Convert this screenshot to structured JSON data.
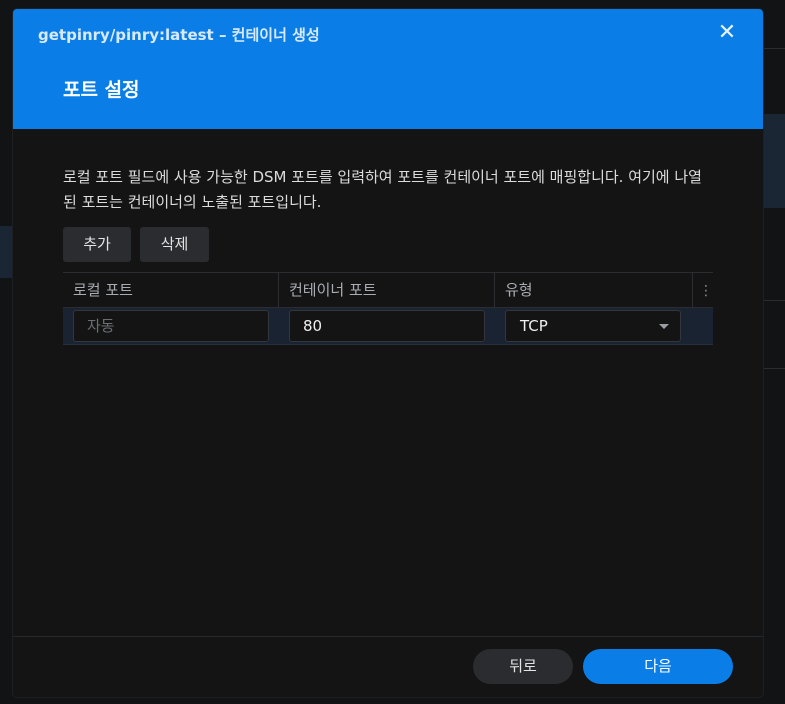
{
  "window": {
    "title": "getpinry/pinry:latest – 컨테이너 생성",
    "close_glyph": "✕"
  },
  "step": {
    "title": "포트 설정"
  },
  "description": "로컬 포트 필드에 사용 가능한 DSM 포트를 입력하여 포트를 컨테이너 포트에 매핑합니다. 여기에 나열된 포트는 컨테이너의 노출된 포트입니다.",
  "toolbar": {
    "add_label": "추가",
    "delete_label": "삭제"
  },
  "table": {
    "columns": [
      "로컬 포트",
      "컨테이너 포트",
      "유형"
    ],
    "column_menu_icon": "vertical-ellipsis-icon",
    "rows": [
      {
        "local_port_value": "",
        "local_port_placeholder": "자동",
        "container_port_value": "80",
        "type": "TCP"
      }
    ]
  },
  "footer": {
    "back_label": "뒤로",
    "next_label": "다음"
  },
  "colors": {
    "accent": "#0a7ee6",
    "dialog_bg": "#141414",
    "selected_row": "#192331"
  }
}
